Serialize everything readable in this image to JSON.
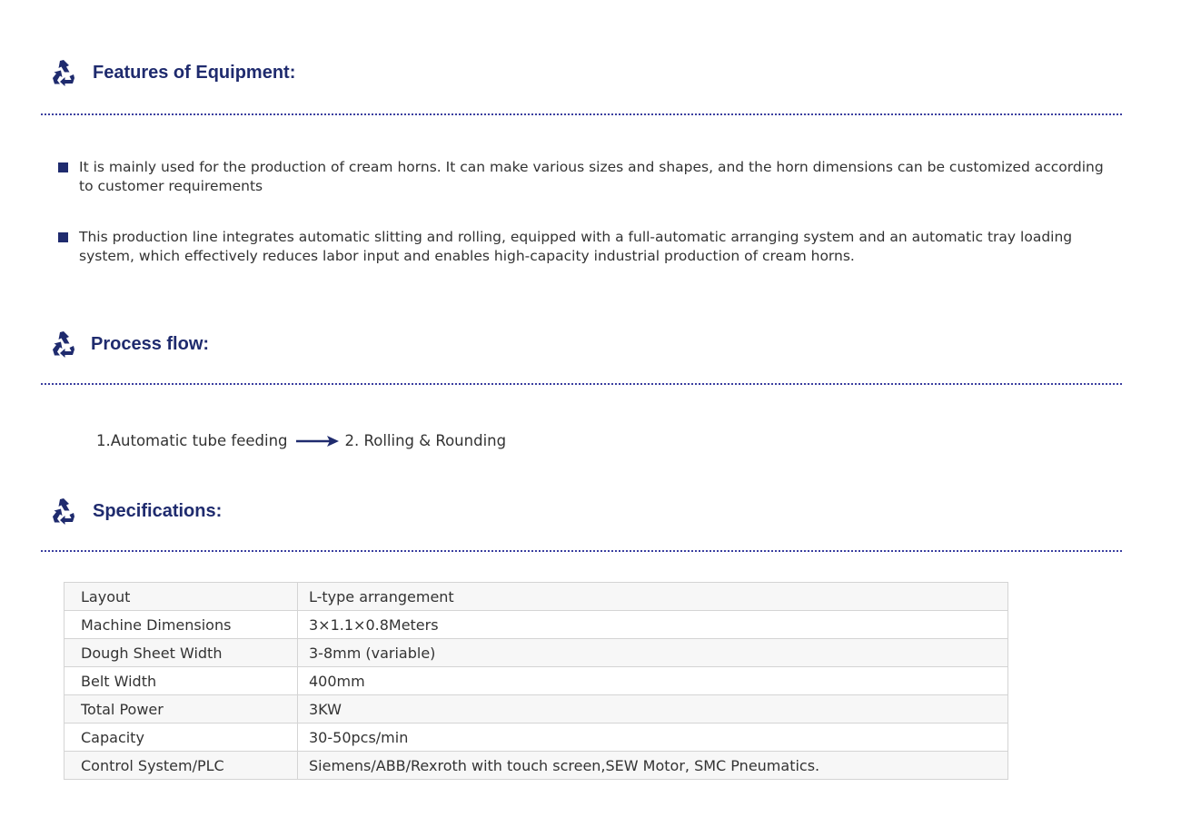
{
  "features": {
    "title": "Features of Equipment:",
    "icon": "recycle-icon",
    "bullets": [
      "It is mainly used for the production of cream horns. It can make various sizes and shapes, and the horn dimensions can be customized according to customer requirements",
      "This production line integrates automatic slitting and rolling, equipped with a full-automatic arranging system and an automatic tray loading system, which effectively reduces labor input and enables high-capacity industrial production of cream horns."
    ]
  },
  "process": {
    "title": "Process flow:",
    "icon": "recycle-icon",
    "steps": [
      "1.Automatic tube feeding",
      "2. Rolling & Rounding"
    ],
    "arrow_icon": "arrow-right-icon"
  },
  "specs": {
    "title": "Specifications:",
    "icon": "recycle-icon",
    "rows": [
      {
        "label": "Layout",
        "value": "L-type arrangement"
      },
      {
        "label": "Machine Dimensions",
        "value": "3×1.1×0.8Meters"
      },
      {
        "label": "Dough Sheet Width",
        "value": "3-8mm (variable)"
      },
      {
        "label": "Belt Width",
        "value": "400mm"
      },
      {
        "label": "Total Power",
        "value": "3KW"
      },
      {
        "label": "Capacity",
        "value": "30-50pcs/min"
      },
      {
        "label": "Control System/PLC",
        "value": "Siemens/ABB/Rexroth with touch screen,SEW Motor, SMC Pneumatics."
      }
    ]
  },
  "colors": {
    "accent": "#1f2b6e",
    "dotline": "#3b3fa0",
    "text": "#333333"
  }
}
